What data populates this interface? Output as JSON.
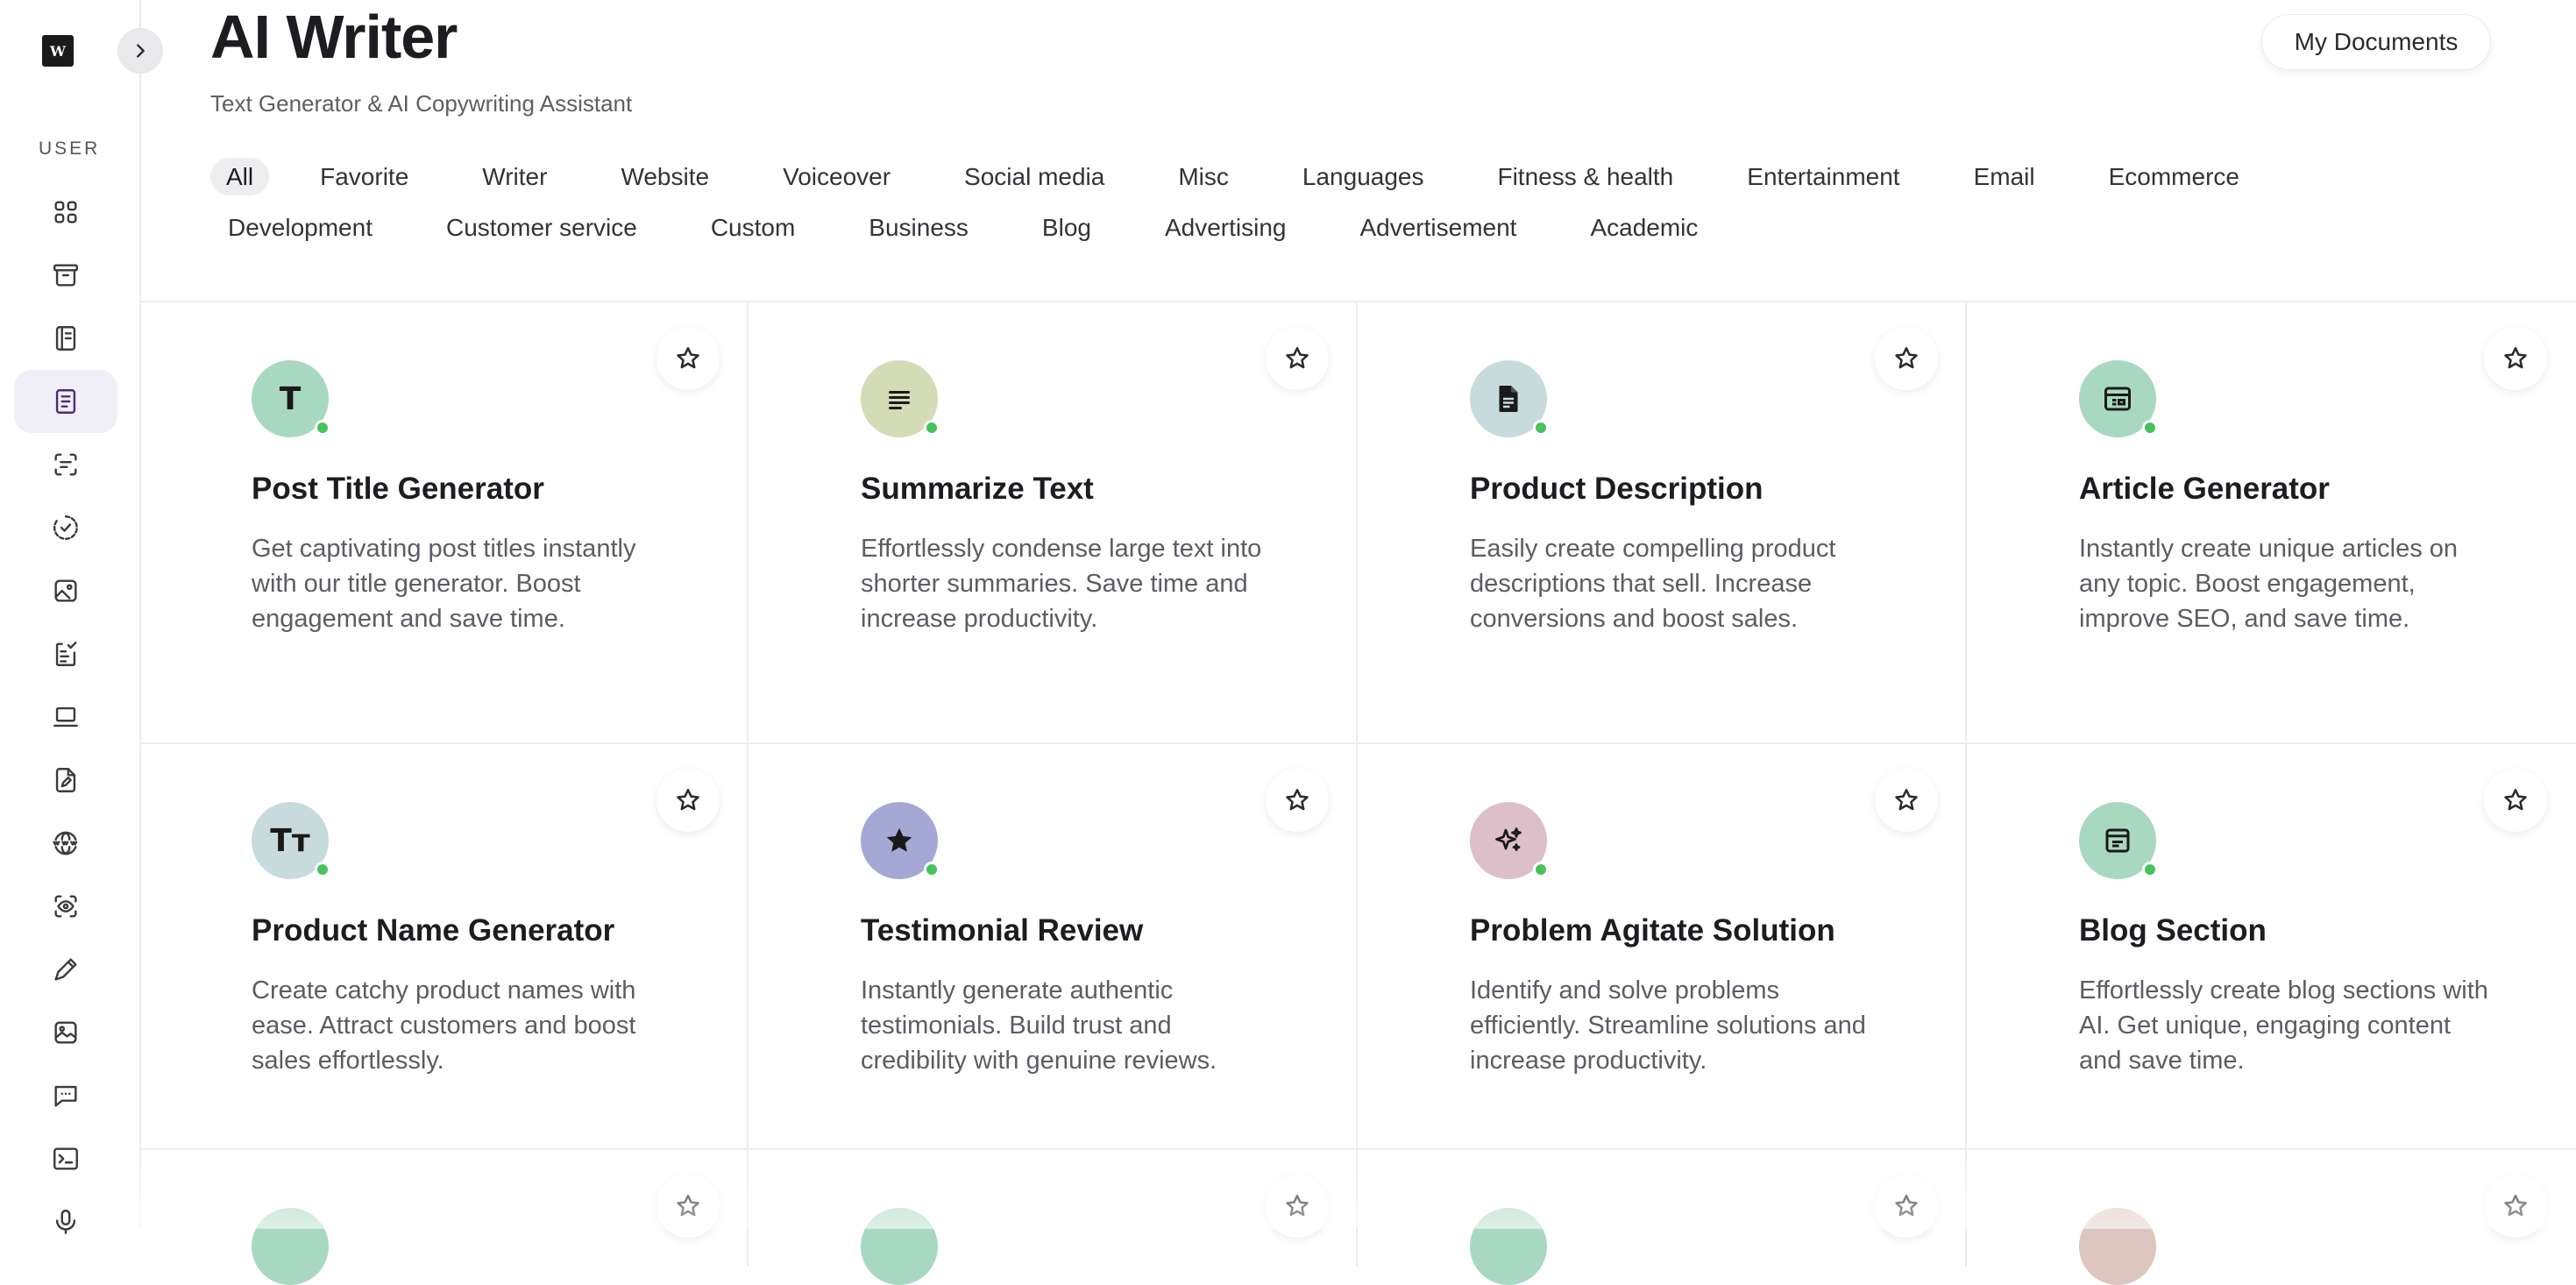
{
  "sidebar": {
    "logo_text": "W",
    "section_heading": "USER",
    "items": [
      {
        "icon": "dashboard-icon"
      },
      {
        "icon": "archive-icon"
      },
      {
        "icon": "book-icon"
      },
      {
        "icon": "document-icon",
        "active": true
      },
      {
        "icon": "scan-text-icon"
      },
      {
        "icon": "check-circle-icon"
      },
      {
        "icon": "image-icon"
      },
      {
        "icon": "clipboard-list-icon"
      },
      {
        "icon": "laptop-icon"
      },
      {
        "icon": "file-edit-icon"
      },
      {
        "icon": "www-globe-icon"
      },
      {
        "icon": "eye-scan-icon"
      },
      {
        "icon": "pen-icon"
      },
      {
        "icon": "image-alt-icon"
      },
      {
        "icon": "chat-icon"
      },
      {
        "icon": "terminal-icon"
      },
      {
        "icon": "microphone-icon"
      }
    ]
  },
  "header": {
    "title": "AI Writer",
    "subtitle": "Text Generator & AI Copywriting Assistant",
    "my_documents_label": "My Documents"
  },
  "filters": [
    "All",
    "Favorite",
    "Writer",
    "Website",
    "Voiceover",
    "Social media",
    "Misc",
    "Languages",
    "Fitness & health",
    "Entertainment",
    "Email",
    "Ecommerce",
    "Development",
    "Customer service",
    "Custom",
    "Business",
    "Blog",
    "Advertising",
    "Advertisement",
    "Academic"
  ],
  "active_filter": "All",
  "colors": {
    "status_online": "#47c35b",
    "active_nav_bg": "#f0eef6"
  },
  "cards": [
    {
      "title": "Post Title Generator",
      "description": "Get captivating post titles instantly with our title generator. Boost engagement and save time.",
      "icon": "letter-t-icon",
      "icon_text": "T",
      "icon_bg": "#a9d8c1"
    },
    {
      "title": "Summarize Text",
      "description": "Effortlessly condense large text into shorter summaries. Save time and increase productivity.",
      "icon": "text-lines-icon",
      "icon_bg": "#d4dcb5"
    },
    {
      "title": "Product Description",
      "description": "Easily create compelling product descriptions that sell. Increase conversions and boost sales.",
      "icon": "file-text-icon",
      "icon_bg": "#c8dbdc"
    },
    {
      "title": "Article Generator",
      "description": "Instantly create unique articles on any topic. Boost engagement, improve SEO, and save time.",
      "icon": "newspaper-icon",
      "icon_bg": "#a9d8c1"
    },
    {
      "title": "Product Name Generator",
      "description": "Create catchy product names with ease. Attract customers and boost sales effortlessly.",
      "icon": "text-size-icon",
      "icon_text": "Tт",
      "icon_bg": "#c8dbdc"
    },
    {
      "title": "Testimonial Review",
      "description": "Instantly generate authentic testimonials. Build trust and credibility with genuine reviews.",
      "icon": "star-filled-icon",
      "icon_bg": "#a5a8d5"
    },
    {
      "title": "Problem Agitate Solution",
      "description": "Identify and solve problems efficiently. Streamline solutions and increase productivity.",
      "icon": "sparkles-icon",
      "icon_bg": "#dcbfc8"
    },
    {
      "title": "Blog Section",
      "description": "Effortlessly create blog sections with AI. Get unique, engaging content and save time.",
      "icon": "browser-window-icon",
      "icon_bg": "#a9d8c1"
    },
    {
      "title": "",
      "description": "",
      "icon": "partial-icon",
      "icon_bg": "#a9d8c1"
    },
    {
      "title": "",
      "description": "",
      "icon": "partial-icon",
      "icon_bg": "#a9d8c1"
    },
    {
      "title": "",
      "description": "",
      "icon": "partial-icon",
      "icon_bg": "#a9d8c1"
    },
    {
      "title": "",
      "description": "",
      "icon": "partial-icon",
      "icon_bg": "#dcc6bf"
    }
  ]
}
